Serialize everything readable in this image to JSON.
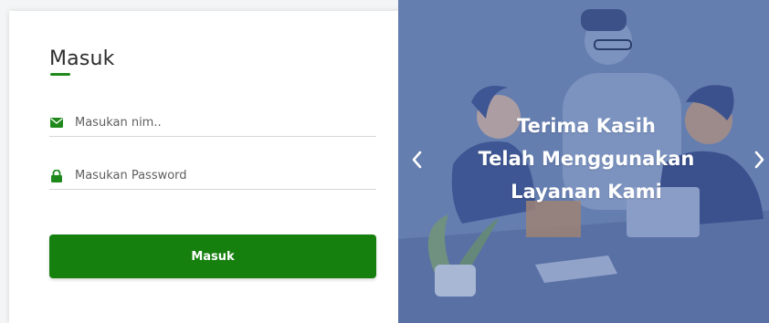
{
  "login": {
    "title": "Masuk",
    "nim_placeholder": "Masukan nim..",
    "password_placeholder": "Masukan Password",
    "submit_label": "Masuk"
  },
  "banner": {
    "caption_lines": [
      "Terima Kasih",
      "Telah Menggunakan",
      "Layanan Kami"
    ]
  },
  "icons": {
    "nim": "envelope-icon",
    "password": "lock-icon",
    "prev": "chevron-left-icon",
    "next": "chevron-right-icon"
  },
  "colors": {
    "accent": "#16800f",
    "banner_bg": "#6f86b5"
  }
}
